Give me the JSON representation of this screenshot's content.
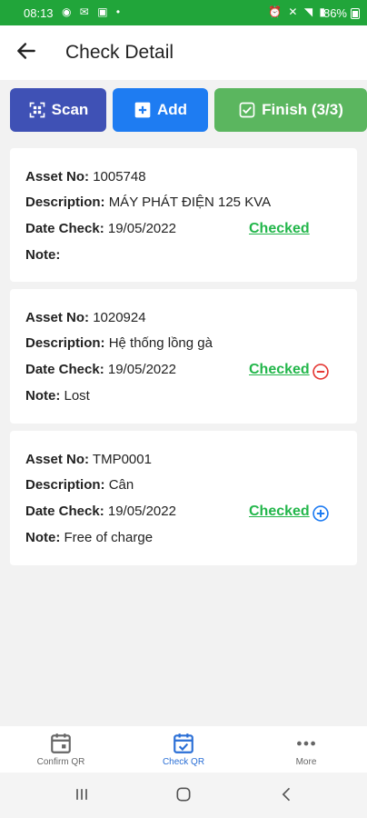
{
  "status_bar": {
    "time": "08:13",
    "battery": "86%"
  },
  "header": {
    "title": "Check Detail"
  },
  "toolbar": {
    "scan_label": "Scan",
    "add_label": "Add",
    "finish_label": "Finish (3/3)"
  },
  "labels": {
    "asset_no": "Asset No:",
    "description": "Description:",
    "date_check": "Date Check:",
    "note": "Note:"
  },
  "items": [
    {
      "asset_no": "1005748",
      "description": "MÁY PHÁT ĐIỆN 125 KVA",
      "date_check": "19/05/2022",
      "note": "",
      "status": "Checked",
      "status_icon": "none"
    },
    {
      "asset_no": "1020924",
      "description": "Hệ thống lồng gà",
      "date_check": "19/05/2022",
      "note": "Lost",
      "status": "Checked",
      "status_icon": "minus-circle-icon"
    },
    {
      "asset_no": "TMP0001",
      "description": "Cân",
      "date_check": "19/05/2022",
      "note": "Free of charge",
      "status": "Checked",
      "status_icon": "plus-circle-icon"
    }
  ],
  "bottom_nav": [
    {
      "label": "Confirm QR",
      "icon": "calendar-icon",
      "active": false
    },
    {
      "label": "Check QR",
      "icon": "calendar-check-icon",
      "active": true
    },
    {
      "label": "More",
      "icon": "more-icon",
      "active": false
    }
  ],
  "colors": {
    "status_bar": "#21a53a",
    "scan": "#3f51b5",
    "add": "#1e7cf2",
    "finish": "#5bb65f",
    "checked": "#22b64a",
    "minus": "#e53935",
    "plus": "#1e7cf2",
    "nav_active": "#2a6fd6"
  }
}
